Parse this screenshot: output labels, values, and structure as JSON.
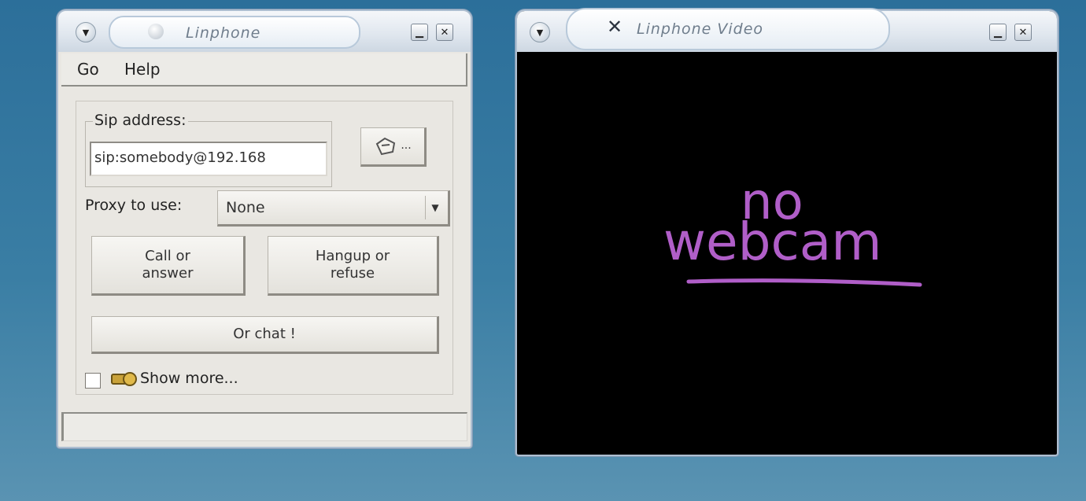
{
  "main_window": {
    "title": "Linphone",
    "menu": [
      "Go",
      "Help"
    ],
    "sip_group_label": "Sip address:",
    "sip_value": "sip:somebody@192.168",
    "addressbook_button": "...",
    "proxy_label": "Proxy to use:",
    "proxy_value": "None",
    "call_button": "Call or answer",
    "hangup_button": "Hangup or refuse",
    "chat_button": "Or chat !",
    "show_more": "Show more...",
    "status_text": ""
  },
  "video_window": {
    "title": "Linphone Video",
    "placeholder_line1": "no",
    "placeholder_line2": "webcam"
  },
  "colors": {
    "desktop": "#3a7ea4",
    "window_bg": "#e9e7e2",
    "video_bg": "#000000",
    "placeholder": "#b05ec8"
  }
}
